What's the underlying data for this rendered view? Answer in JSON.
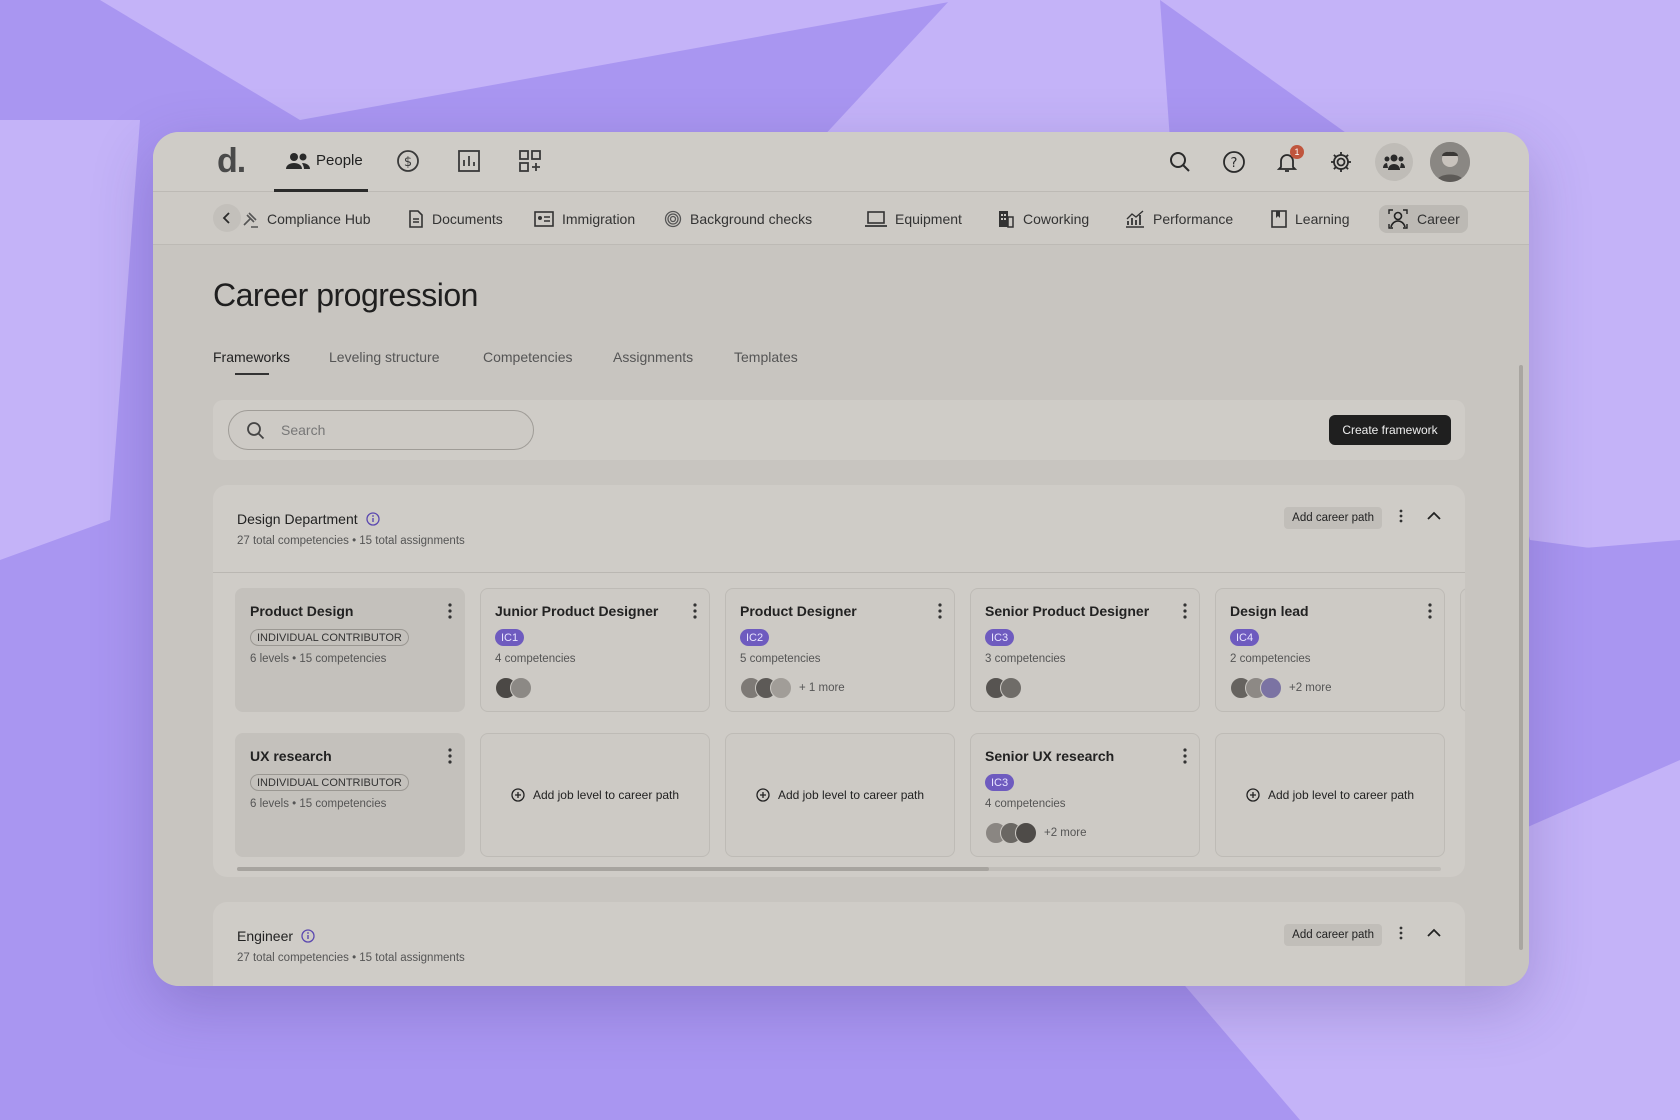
{
  "app": {
    "logo": "d."
  },
  "topnav": {
    "people_label": "People",
    "icons": [
      "payroll-icon",
      "reports-icon",
      "apps-icon"
    ],
    "notification_count": "1"
  },
  "subnav": {
    "items": [
      {
        "label": "Compliance Hub"
      },
      {
        "label": "Documents"
      },
      {
        "label": "Immigration"
      },
      {
        "label": "Background checks"
      },
      {
        "label": "Equipment"
      },
      {
        "label": "Coworking"
      },
      {
        "label": "Performance"
      },
      {
        "label": "Learning"
      },
      {
        "label": "Career"
      }
    ],
    "active": "Career"
  },
  "page": {
    "title": "Career progression",
    "tabs": [
      {
        "label": "Frameworks"
      },
      {
        "label": "Leveling structure"
      },
      {
        "label": "Competencies"
      },
      {
        "label": "Assignments"
      },
      {
        "label": "Templates"
      }
    ],
    "active_tab": "Frameworks",
    "search_placeholder": "Search",
    "create_button": "Create framework"
  },
  "sections": [
    {
      "title": "Design Department",
      "subtitle": "27 total competencies  • 15 total assignments",
      "add_path_label": "Add career path",
      "rows": [
        {
          "path": {
            "title": "Product Design",
            "tag": "INDIVIDUAL CONTRIBUTOR",
            "meta": "6 levels • 15 competencies"
          },
          "levels": [
            {
              "title": "Junior Product Designer",
              "tag": "IC1",
              "meta": "4 competencies",
              "more": ""
            },
            {
              "title": "Product Designer",
              "tag": "IC2",
              "meta": "5 competencies",
              "more": "+ 1 more"
            },
            {
              "title": "Senior Product Designer",
              "tag": "IC3",
              "meta": "3 competencies",
              "more": ""
            },
            {
              "title": "Design lead",
              "tag": "IC4",
              "meta": "2 competencies",
              "more": "+2 more"
            }
          ]
        },
        {
          "path": {
            "title": "UX research",
            "tag": "INDIVIDUAL CONTRIBUTOR",
            "meta": "6 levels • 15 competencies"
          },
          "levels": [
            {
              "add_label": "Add job level to career path"
            },
            {
              "add_label": "Add job level to career path"
            },
            {
              "title": "Senior UX research",
              "tag": "IC3",
              "meta": "4 competencies",
              "more": "+2 more"
            },
            {
              "add_label": "Add job level to career path"
            }
          ]
        }
      ]
    },
    {
      "title": "Engineer",
      "subtitle": "27 total competencies  • 15 total assignments",
      "add_path_label": "Add career path"
    }
  ]
}
